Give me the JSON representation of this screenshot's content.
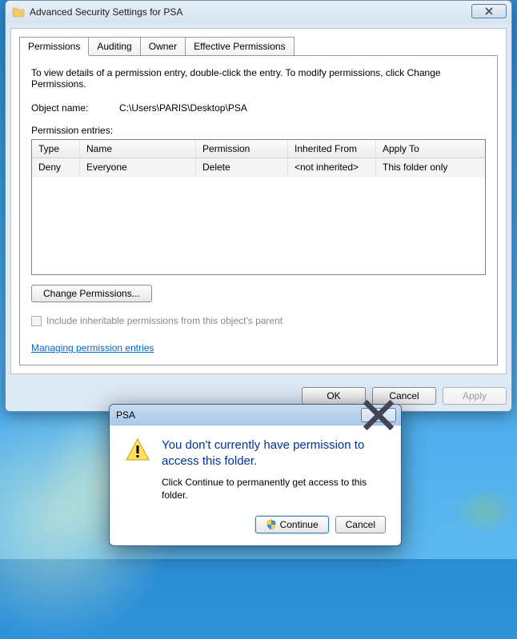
{
  "mainWindow": {
    "title": "Advanced Security Settings for PSA",
    "tabs": [
      "Permissions",
      "Auditing",
      "Owner",
      "Effective Permissions"
    ],
    "activeTab": 0,
    "infoText": "To view details of a permission entry, double-click the entry. To modify permissions, click Change Permissions.",
    "objectNameLabel": "Object name:",
    "objectName": "C:\\Users\\PARIS\\Desktop\\PSA",
    "entriesLabel": "Permission entries:",
    "columns": {
      "type": "Type",
      "name": "Name",
      "permission": "Permission",
      "inherited": "Inherited From",
      "apply": "Apply To"
    },
    "rows": [
      {
        "type": "Deny",
        "name": "Everyone",
        "permission": "Delete",
        "inherited": "<not inherited>",
        "apply": "This folder only"
      }
    ],
    "changeBtn": "Change Permissions...",
    "includeInheritLabel": "Include inheritable permissions from this object's parent",
    "includeInheritChecked": false,
    "link": "Managing permission entries",
    "buttons": {
      "ok": "OK",
      "cancel": "Cancel",
      "apply": "Apply"
    }
  },
  "dialog": {
    "title": "PSA",
    "heading": "You don't currently have permission to access this folder.",
    "body": "Click Continue to permanently get access to this folder.",
    "continueBtn": "Continue",
    "cancelBtn": "Cancel"
  }
}
